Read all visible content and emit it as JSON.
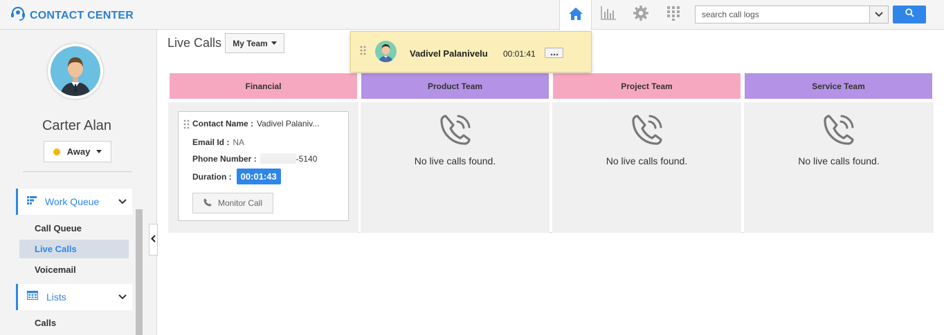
{
  "header": {
    "brand": "CONTACT CENTER",
    "nav": [
      "home-icon",
      "reports-icon",
      "settings-icon",
      "apps-grid-icon"
    ],
    "search_placeholder": "search call logs"
  },
  "sidebar": {
    "user_name": "Carter Alan",
    "status": "Away",
    "status_color": "#f5b800",
    "sections": [
      {
        "label": "Work Queue",
        "items": [
          "Call Queue",
          "Live Calls",
          "Voicemail"
        ]
      },
      {
        "label": "Lists",
        "items": [
          "Calls"
        ]
      }
    ],
    "active_item": "Live Calls"
  },
  "main": {
    "title": "Live Calls",
    "team_filter": "My Team",
    "active_call": {
      "name": "Vadivel Palanivelu",
      "time": "00:01:41"
    },
    "columns": [
      {
        "name": "Financial",
        "color": "#f7a8c1"
      },
      {
        "name": "Product Team",
        "color": "#b492e5"
      },
      {
        "name": "Project Team",
        "color": "#f7a8c1"
      },
      {
        "name": "Service Team",
        "color": "#b492e5"
      }
    ],
    "call_card": {
      "contact_label": "Contact Name :",
      "contact_value": "Vadivel Palaniv...",
      "email_label": "Email Id :",
      "email_value": "NA",
      "phone_label": "Phone Number :",
      "phone_value": "-5140",
      "duration_label": "Duration :",
      "duration_value": "00:01:43",
      "monitor_label": "Monitor Call"
    },
    "empty_message": "No live calls found."
  },
  "colors": {
    "accent": "#2f86e8"
  }
}
